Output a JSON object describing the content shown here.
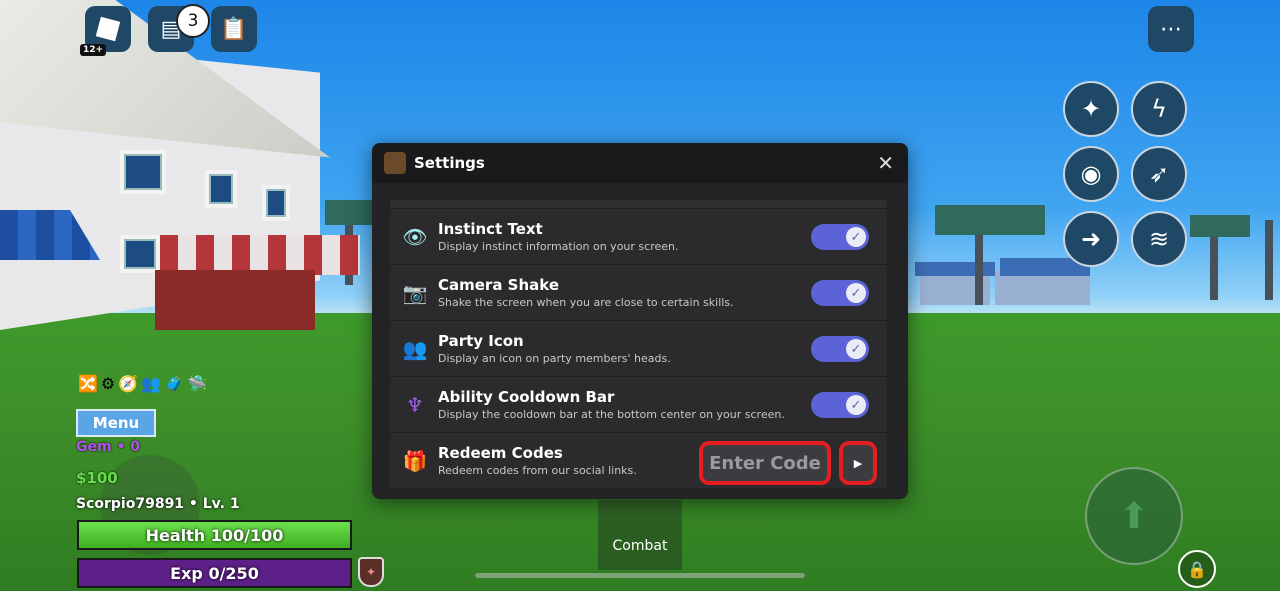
{
  "top_bar": {
    "age_rating": "12+",
    "notification_count": "3"
  },
  "settings": {
    "title": "Settings",
    "close_glyph": "✕",
    "rows": [
      {
        "icon": "eye-icon",
        "glyph": "👁",
        "title": "Instinct Text",
        "desc": "Display instinct information on your screen.",
        "enabled": true
      },
      {
        "icon": "camera-icon",
        "glyph": "📷",
        "title": "Camera Shake",
        "desc": "Shake the screen when you are close to certain skills.",
        "enabled": true
      },
      {
        "icon": "party-icon",
        "glyph": "👥",
        "title": "Party Icon",
        "desc": "Display an icon on party members' heads.",
        "enabled": true
      },
      {
        "icon": "cooldown-icon",
        "glyph": "♆",
        "title": "Ability Cooldown Bar",
        "desc": "Display the cooldown bar at the bottom center on your screen.",
        "enabled": true
      }
    ],
    "redeem": {
      "title": "Redeem Codes",
      "desc": "Redeem codes from our social links.",
      "placeholder": "Enter Code"
    }
  },
  "hud": {
    "menu_label": "Menu",
    "gem": "Gem • 0",
    "money": "$100",
    "player": "Scorpio79891 • Lv. 1",
    "health": "Health 100/100",
    "health_fraction": 1.0,
    "exp": "Exp 0/250",
    "exp_fraction": 0.0,
    "combat_label": "Combat"
  },
  "skills": [
    "sparkle-icon",
    "lightning-icon",
    "eye-icon",
    "dash-icon",
    "arrow-icon",
    "tornado-icon"
  ],
  "colors": {
    "toggle_on": "#5c63d9",
    "highlight": "#e41e1e",
    "health": "#4cc02c",
    "exp": "#5d1f88"
  }
}
